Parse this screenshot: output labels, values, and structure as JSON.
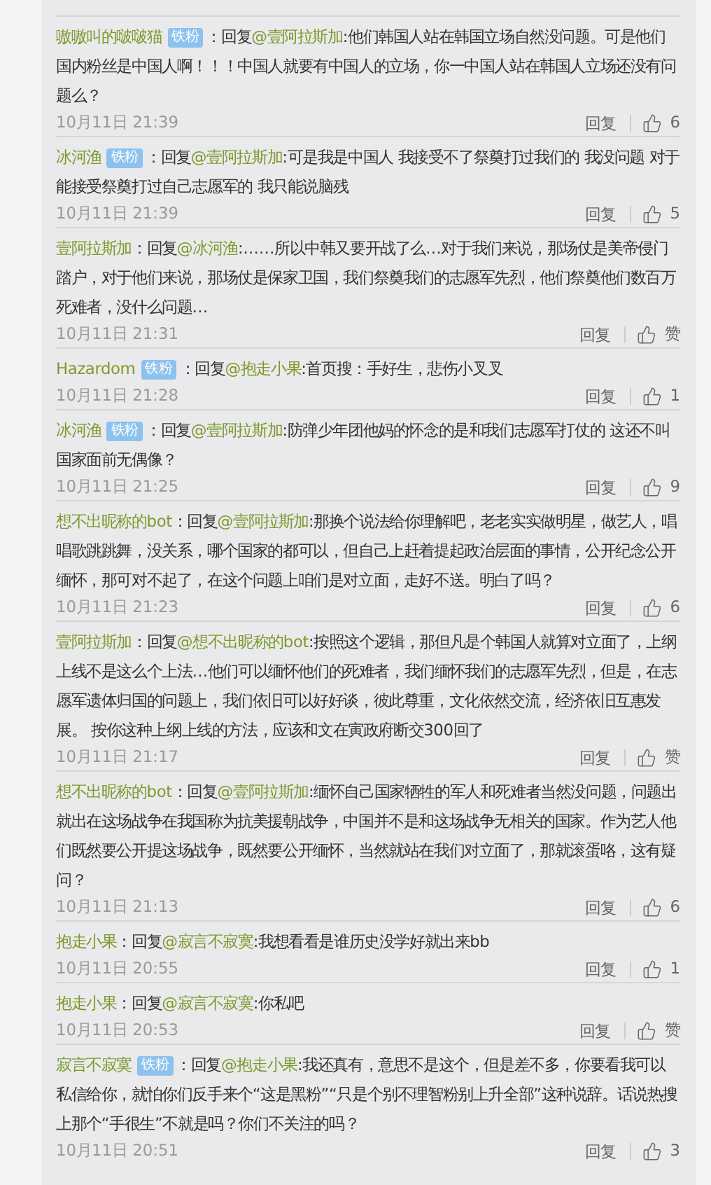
{
  "comments": [
    {
      "author": "嗷嗷叫的啵啵猫",
      "badge": "铁粉",
      "prefix": "：回复",
      "reply_to": "@壹阿拉斯加",
      "text": ":他们韩国人站在韩国立场自然没问题。可是他们国内粉丝是中国人啊！！！中国人就要有中国人的立场，你一中国人站在韩国人立场还没有问题么？",
      "time": "10月11日 21:39",
      "reply_label": "回复",
      "likes": "6"
    },
    {
      "author": "冰河渔",
      "badge": "铁粉",
      "prefix": "：回复",
      "reply_to": "@壹阿拉斯加",
      "text": ":可是我是中国人 我接受不了祭奠打过我们的 我没问题 对于能接受祭奠打过自己志愿军的 我只能说脑残",
      "time": "10月11日 21:39",
      "reply_label": "回复",
      "likes": "5"
    },
    {
      "author": "壹阿拉斯加",
      "prefix": "：回复",
      "reply_to": "@冰河渔",
      "text": ":……所以中韩又要开战了么…对于我们来说，那场仗是美帝侵门踏户，对于他们来说，那场仗是保家卫国，我们祭奠我们的志愿军先烈，他们祭奠他们数百万死难者，没什么问题…",
      "time": "10月11日 21:31",
      "reply_label": "回复",
      "likes": "赞"
    },
    {
      "author": "Hazardom",
      "badge": "铁粉",
      "prefix": "：回复",
      "reply_to": "@抱走小果",
      "text": ":首页搜：手好生，悲伤小叉叉",
      "time": "10月11日 21:28",
      "reply_label": "回复",
      "likes": "1"
    },
    {
      "author": "冰河渔",
      "badge": "铁粉",
      "prefix": "：回复",
      "reply_to": "@壹阿拉斯加",
      "text": ":防弹少年团他妈的怀念的是和我们志愿军打仗的 这还不叫国家面前无偶像？",
      "time": "10月11日 21:25",
      "reply_label": "回复",
      "likes": "9"
    },
    {
      "author": "想不出昵称的bot",
      "prefix": "：回复",
      "reply_to": "@壹阿拉斯加",
      "text": ":那换个说法给你理解吧，老老实实做明星，做艺人，唱唱歌跳跳舞，没关系，哪个国家的都可以，但自己上赶着提起政治层面的事情，公开纪念公开缅怀，那可对不起了，在这个问题上咱们是对立面，走好不送。明白了吗？",
      "time": "10月11日 21:23",
      "reply_label": "回复",
      "likes": "6"
    },
    {
      "author": "壹阿拉斯加",
      "prefix": "：回复",
      "reply_to": "@想不出昵称的bot",
      "text": ":按照这个逻辑，那但凡是个韩国人就算对立面了，上纲上线不是这么个上法…他们可以缅怀他们的死难者，我们缅怀我们的志愿军先烈，但是，在志愿军遗体归国的问题上，我们依旧可以好好谈，彼此尊重，文化依然交流，经济依旧互惠发展。 按你这种上纲上线的方法，应该和文在寅政府断交300回了",
      "time": "10月11日 21:17",
      "reply_label": "回复",
      "likes": "赞"
    },
    {
      "author": "想不出昵称的bot",
      "prefix": "：回复",
      "reply_to": "@壹阿拉斯加",
      "text": ":缅怀自己国家牺牲的军人和死难者当然没问题，问题出就出在这场战争在我国称为抗美援朝战争，中国并不是和这场战争无相关的国家。作为艺人他们既然要公开提这场战争，既然要公开缅怀，当然就站在我们对立面了，那就滚蛋咯，这有疑问？",
      "time": "10月11日 21:13",
      "reply_label": "回复",
      "likes": "6"
    },
    {
      "author": "抱走小果",
      "prefix": "：回复",
      "reply_to": "@寂言不寂寞",
      "text": ":我想看看是谁历史没学好就出来bb",
      "time": "10月11日 20:55",
      "reply_label": "回复",
      "likes": "1"
    },
    {
      "author": "抱走小果",
      "prefix": "：回复",
      "reply_to": "@寂言不寂寞",
      "text": ":你私吧",
      "time": "10月11日 20:53",
      "reply_label": "回复",
      "likes": "赞"
    },
    {
      "author": "寂言不寂寞",
      "badge": "铁粉",
      "prefix": "：回复",
      "reply_to": "@抱走小果",
      "text": ":我还真有，意思不是这个，但是差不多，你要看我可以私信给你，就怕你们反手来个“这是黑粉”“只是个别不理智粉别上升全部”这种说辞。话说热搜上那个“手很生”不就是吗？你们不关注的吗？",
      "time": "10月11日 20:51",
      "reply_label": "回复",
      "likes": "3"
    }
  ]
}
